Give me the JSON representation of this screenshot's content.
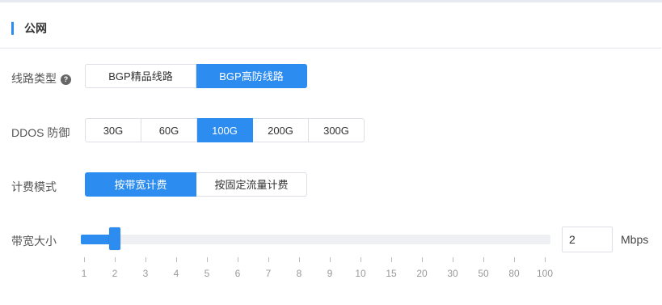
{
  "section": {
    "title": "公网"
  },
  "line_type": {
    "label": "线路类型",
    "help_icon": "question-circle-icon",
    "options": [
      "BGP精品线路",
      "BGP高防线路"
    ],
    "selected": "BGP高防线路"
  },
  "ddos": {
    "label": "DDOS 防御",
    "options": [
      "30G",
      "60G",
      "100G",
      "200G",
      "300G"
    ],
    "selected": "100G"
  },
  "billing": {
    "label": "计费模式",
    "options": [
      "按带宽计费",
      "按固定流量计费"
    ],
    "selected": "按带宽计费"
  },
  "bandwidth": {
    "label": "带宽大小",
    "value": "2",
    "unit": "Mbps",
    "ticks": [
      "1",
      "2",
      "3",
      "4",
      "5",
      "6",
      "7",
      "8",
      "9",
      "10",
      "15",
      "20",
      "30",
      "50",
      "80",
      "100"
    ]
  },
  "colors": {
    "accent": "#2d8cf0"
  }
}
